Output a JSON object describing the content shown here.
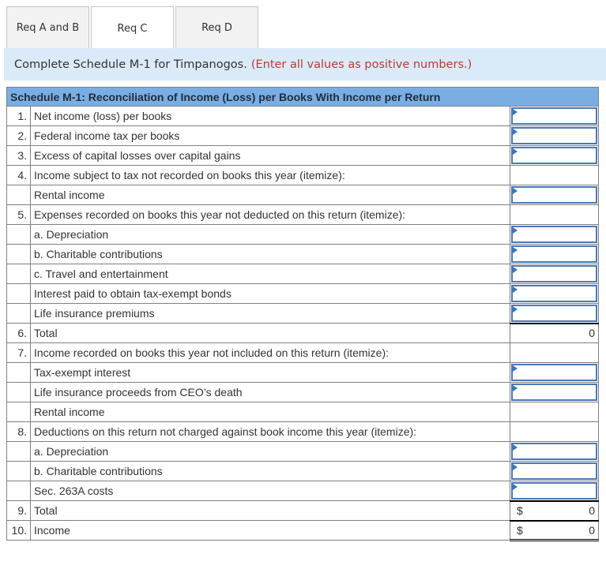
{
  "tabs": [
    {
      "label": "Req A and B",
      "active": false
    },
    {
      "label": "Req C",
      "active": true
    },
    {
      "label": "Req D",
      "active": false
    }
  ],
  "instruction": {
    "text": "Complete Schedule M-1 for Timpanogos.",
    "note": "(Enter all values as positive numbers.)"
  },
  "schedule": {
    "title": "Schedule M-1: Reconciliation of Income (Loss) per Books With Income per Return",
    "rows": [
      {
        "num": "1.",
        "label": "Net income (loss) per books",
        "type": "input",
        "value": ""
      },
      {
        "num": "2.",
        "label": "Federal income tax per books",
        "type": "input",
        "value": ""
      },
      {
        "num": "3.",
        "label": "Excess of capital losses over capital gains",
        "type": "input",
        "value": ""
      },
      {
        "num": "4.",
        "label": "Income subject to tax not recorded on books this year (itemize):",
        "type": "none",
        "value": ""
      },
      {
        "num": "",
        "label": "Rental income",
        "type": "input",
        "value": ""
      },
      {
        "num": "5.",
        "label": "Expenses recorded on books this year not deducted on this return (itemize):",
        "type": "none",
        "value": ""
      },
      {
        "num": "",
        "label": "a. Depreciation",
        "type": "input",
        "value": ""
      },
      {
        "num": "",
        "label": "b. Charitable contributions",
        "type": "input",
        "value": ""
      },
      {
        "num": "",
        "label": "c. Travel and entertainment",
        "type": "input",
        "value": ""
      },
      {
        "num": "",
        "label": "Interest paid to obtain tax-exempt bonds",
        "type": "input",
        "value": ""
      },
      {
        "num": "",
        "label": "Life insurance premiums",
        "type": "input",
        "value": ""
      },
      {
        "num": "6.",
        "label": "Total",
        "type": "calc",
        "value": "0"
      },
      {
        "num": "7.",
        "label": "Income recorded on books this year not included on this return (itemize):",
        "type": "none",
        "value": ""
      },
      {
        "num": "",
        "label": "Tax-exempt interest",
        "type": "input",
        "value": ""
      },
      {
        "num": "",
        "label": "Life insurance proceeds from CEO’s death",
        "type": "input",
        "value": ""
      },
      {
        "num": "",
        "label": "Rental income",
        "type": "none",
        "value": ""
      },
      {
        "num": "8.",
        "label": "Deductions on this return not charged against book income this year (itemize):",
        "type": "none",
        "value": ""
      },
      {
        "num": "",
        "label": "a. Depreciation",
        "type": "input",
        "value": ""
      },
      {
        "num": "",
        "label": "b. Charitable contributions",
        "type": "input",
        "value": ""
      },
      {
        "num": "",
        "label": "Sec. 263A costs",
        "type": "input",
        "value": ""
      },
      {
        "num": "9.",
        "label": "Total",
        "type": "calc-dollar",
        "currency": "$",
        "value": "0"
      },
      {
        "num": "10.",
        "label": "Income",
        "type": "calc-dollar",
        "currency": "$",
        "value": "0"
      }
    ]
  }
}
